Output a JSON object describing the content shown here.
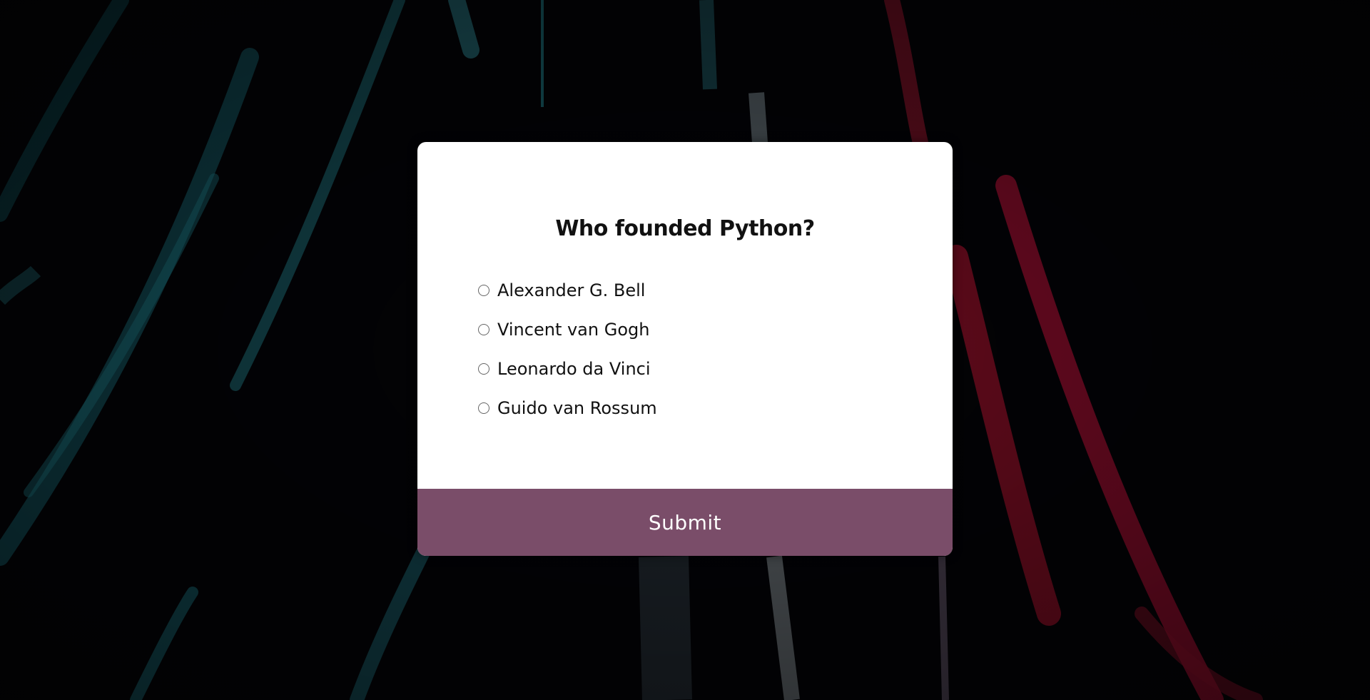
{
  "quiz": {
    "question": "Who founded Python?",
    "options": [
      {
        "label": "Alexander G. Bell",
        "selected": false
      },
      {
        "label": "Vincent van Gogh",
        "selected": false
      },
      {
        "label": "Leonardo da Vinci",
        "selected": false
      },
      {
        "label": "Guido van Rossum",
        "selected": false
      }
    ],
    "submit_label": "Submit"
  },
  "colors": {
    "background": "#030306",
    "card": "#ffffff",
    "accent": "#7a4d69",
    "text": "#111111"
  },
  "background": {
    "description_icon": "neon-light-streaks-background"
  }
}
